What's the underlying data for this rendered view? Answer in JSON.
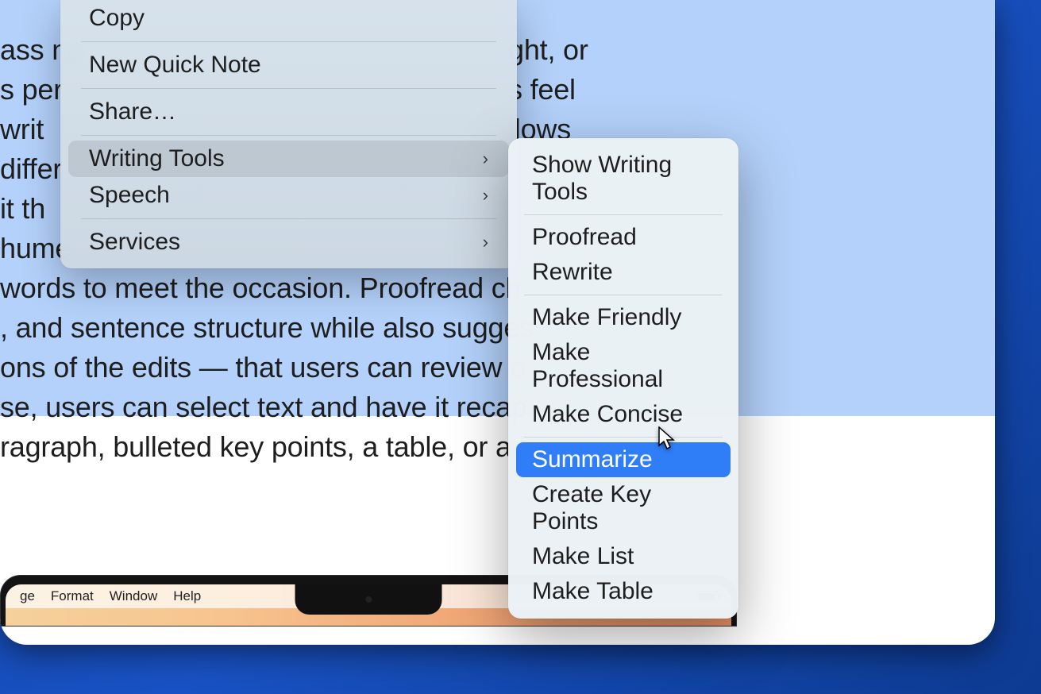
{
  "document": {
    "lines": [
      "ass no",
      "s per",
      "writ",
      "differ",
      "it th",
      "hume",
      "words to meet the occasion. Proofread ch",
      ", and sentence structure while also sugges",
      "ons of the edits — that users can review o",
      "se, users can select text and have it recap",
      "ragraph, bulleted key points, a table, or a l"
    ],
    "line_right": [
      "ght, or",
      "s feel",
      "llows"
    ]
  },
  "context_menu": {
    "copy": "Copy",
    "new_quick_note": "New Quick Note",
    "share": "Share…",
    "writing_tools": "Writing Tools",
    "speech": "Speech",
    "services": "Services"
  },
  "submenu": {
    "show_writing_tools": "Show Writing Tools",
    "proofread": "Proofread",
    "rewrite": "Rewrite",
    "make_friendly": "Make Friendly",
    "make_professional": "Make Professional",
    "make_concise": "Make Concise",
    "summarize": "Summarize",
    "create_key_points": "Create Key Points",
    "make_list": "Make List",
    "make_table": "Make Table"
  },
  "menubar": {
    "items": [
      "ge",
      "Format",
      "Window",
      "Help"
    ]
  }
}
